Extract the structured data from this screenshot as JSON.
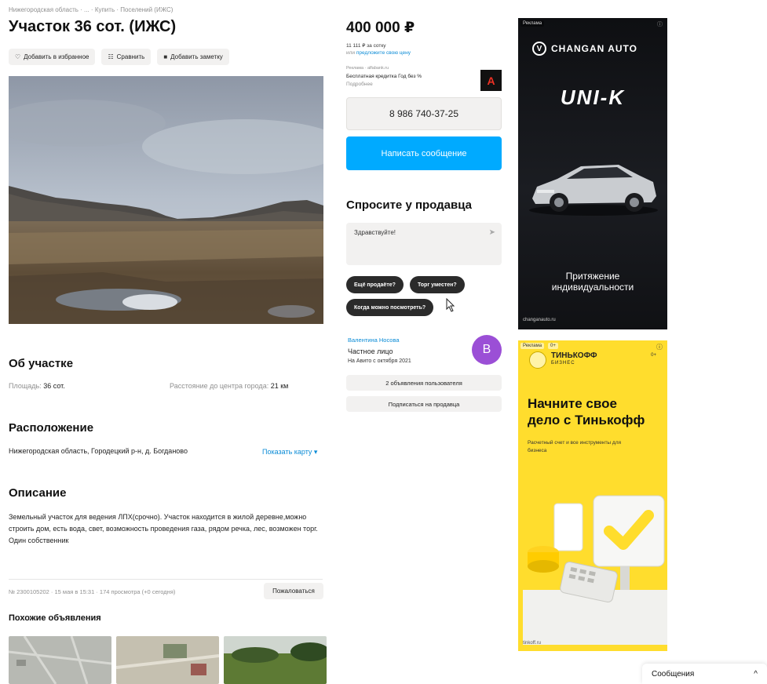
{
  "breadcrumbs": "Нижегородская область · ... · Купить · Поселений (ИЖС)",
  "listing": {
    "title": "Участок 36 сот. (ИЖС)",
    "actions": [
      {
        "label": "Добавить в избранное",
        "icon": "heart-icon",
        "glyph": "♡"
      },
      {
        "label": "Сравнить",
        "icon": "compare-icon",
        "glyph": "☷"
      },
      {
        "label": "Добавить заметку",
        "icon": "note-icon",
        "glyph": "■"
      }
    ]
  },
  "about": {
    "heading": "Об участке",
    "area_label": "Площадь:",
    "area_value": "36 сот.",
    "distance_label": "Расстояние до центра города:",
    "distance_value": "21 км"
  },
  "location": {
    "heading": "Расположение",
    "address": "Нижегородская область, Городецкий р-н, д. Богданово",
    "map_link": "Показать карту ▾"
  },
  "description": {
    "heading": "Описание",
    "text": "Земельный участок для ведения ЛПХ(срочно). Участок находится в жилой деревне,можно строить дом, есть вода, свет, возможность проведения газа, рядом речка, лес, возможен торг. Один собственник"
  },
  "meta": {
    "line": "№ 2300105202 · 15 мая в 15:31 · 174 просмотра (+0 сегодня)",
    "complain": "Пожаловаться"
  },
  "similar": {
    "heading": "Похожие объявления"
  },
  "sidebar": {
    "price": "400 000 ₽",
    "price_per": "11 111 ₽ за сотку",
    "offer_prefix": "или",
    "offer_link": "предложите свою цену",
    "credit_ad": "Реклама · alfabank.ru",
    "credit_text": "Бесплатная кредитка Год без %",
    "credit_more": "Подробнее",
    "credit_logo": "А",
    "phone": "8 986 740-37-25",
    "write": "Написать сообщение",
    "ask_title": "Спросите у продавца",
    "ask_placeholder": "Здравствуйте!",
    "chips": [
      "Ещё продаёте?",
      "Торг уместен?",
      "Когда можно посмотреть?"
    ],
    "seller_name": "Валентина Носова",
    "seller_type": "Частное лицо",
    "seller_since": "На Авито с октября 2021",
    "avatar_letter": "В",
    "btn_listings": "2 объявления пользователя",
    "btn_subscribe": "Подписаться на продавца"
  },
  "ad_changan": {
    "label": "Реклама",
    "brand": "CHANGAN AUTO",
    "model": "UNI-K",
    "slogan_1": "Притяжение",
    "slogan_2": "индивидуальности",
    "site": "changanauto.ru"
  },
  "ad_tinkoff": {
    "label": "Реклама",
    "age": "0+",
    "brand": "ТИНЬКОФФ",
    "brand_sub": "БИЗНЕС",
    "headline_1": "Начните свое",
    "headline_2": "дело с Тинькофф",
    "sub": "Расчетный счет и все инструменты для бизнеса",
    "corner_age": "0+",
    "site": "tinkoff.ru"
  },
  "messages": {
    "label": "Сообщения",
    "chevron": "^"
  },
  "colors": {
    "accent_blue": "#00aaff",
    "link": "#0a8bd6",
    "avatar": "#9b4fd6",
    "tinkoff_yellow": "#ffdd2d"
  }
}
